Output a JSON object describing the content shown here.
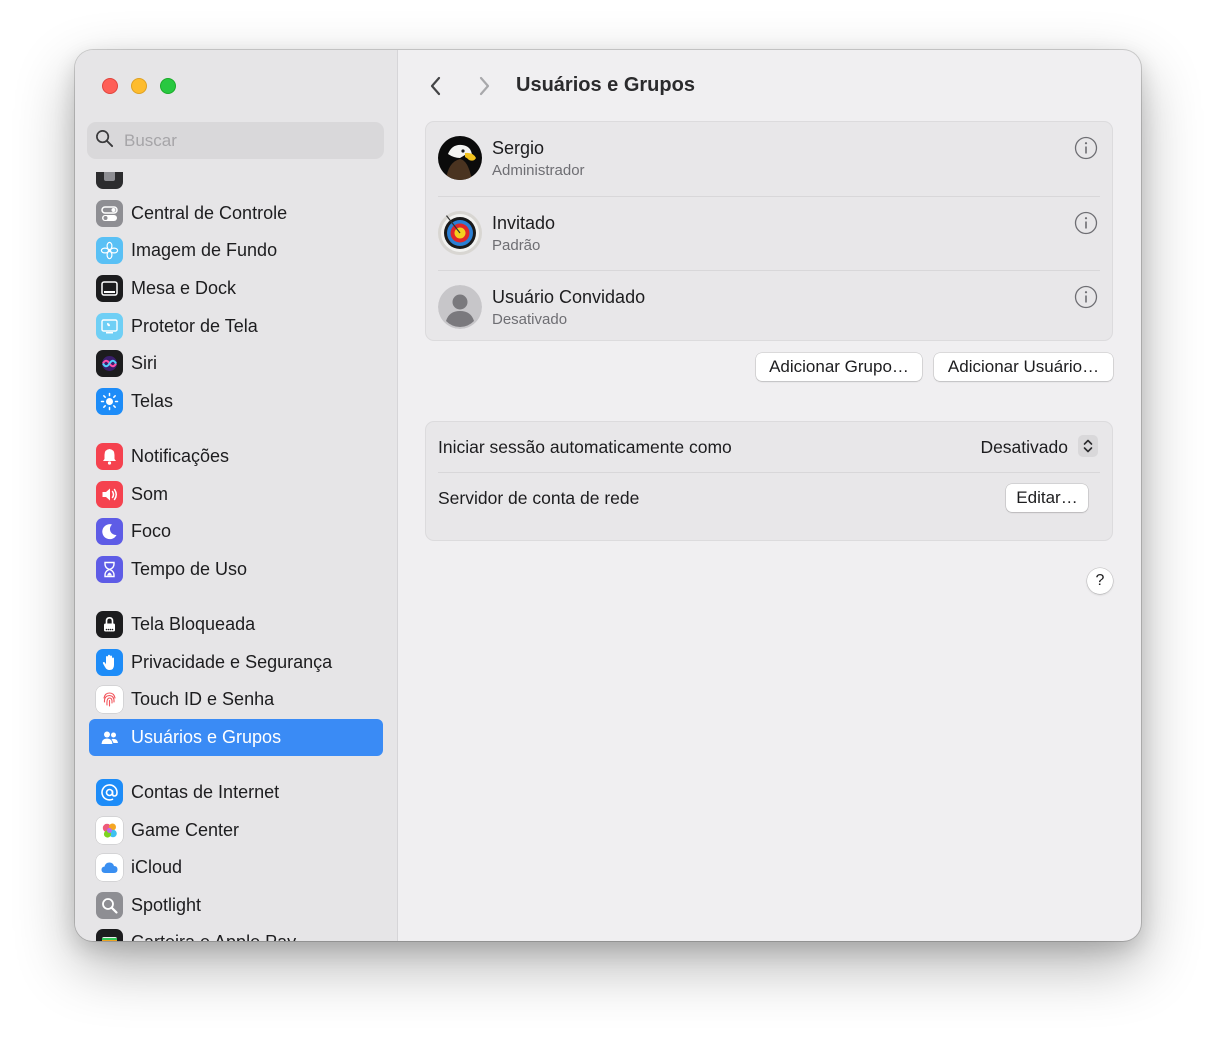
{
  "window": {
    "title": "Usuários e Grupos"
  },
  "search": {
    "placeholder": "Buscar"
  },
  "sidebar": {
    "items": [
      {
        "label": "",
        "icon": "partial-icon",
        "color": "#2c2c2e",
        "group": 0
      },
      {
        "label": "Central de Controle",
        "icon": "toggles-icon",
        "color": "#8e8e93",
        "group": 0
      },
      {
        "label": "Imagem de Fundo",
        "icon": "flower-icon",
        "color": "#59c0f5",
        "group": 0
      },
      {
        "label": "Mesa e Dock",
        "icon": "dock-icon",
        "color": "#1c1c1e",
        "group": 0
      },
      {
        "label": "Protetor de Tela",
        "icon": "screensaver-icon",
        "color": "#6fcff5",
        "group": 0
      },
      {
        "label": "Siri",
        "icon": "siri-icon",
        "color": "#1c1c1e",
        "group": 0
      },
      {
        "label": "Telas",
        "icon": "sun-icon",
        "color": "#1d8cf8",
        "group": 0
      },
      {
        "label": "Notificações",
        "icon": "bell-icon",
        "color": "#f5424f",
        "group": 1
      },
      {
        "label": "Som",
        "icon": "speaker-icon",
        "color": "#f5424f",
        "group": 1
      },
      {
        "label": "Foco",
        "icon": "moon-icon",
        "color": "#5e5ce6",
        "group": 1
      },
      {
        "label": "Tempo de Uso",
        "icon": "hourglass-icon",
        "color": "#5e5ce6",
        "group": 1
      },
      {
        "label": "Tela Bloqueada",
        "icon": "lock-icon",
        "color": "#1c1c1e",
        "group": 2
      },
      {
        "label": "Privacidade e Segurança",
        "icon": "hand-icon",
        "color": "#1d8cf8",
        "group": 2
      },
      {
        "label": "Touch ID e Senha",
        "icon": "fingerprint-icon",
        "color": "#ffffff",
        "group": 2
      },
      {
        "label": "Usuários e Grupos",
        "icon": "users-icon",
        "color": "#1d8cf8",
        "group": 2,
        "selected": true
      },
      {
        "label": "Contas de Internet",
        "icon": "at-icon",
        "color": "#1d8cf8",
        "group": 3
      },
      {
        "label": "Game Center",
        "icon": "gamecenter-icon",
        "color": "#ffffff",
        "group": 3
      },
      {
        "label": "iCloud",
        "icon": "cloud-icon",
        "color": "#ffffff",
        "group": 3
      },
      {
        "label": "Spotlight",
        "icon": "magnifier-icon",
        "color": "#8e8e93",
        "group": 3
      },
      {
        "label": "Carteira e Apple Pay",
        "icon": "wallet-icon",
        "color": "#1c1c1e",
        "group": 3
      }
    ]
  },
  "users": [
    {
      "name": "Sergio",
      "role": "Administrador",
      "avatar": "eagle-avatar"
    },
    {
      "name": "Invitado",
      "role": "Padrão",
      "avatar": "target-avatar"
    },
    {
      "name": "Usuário Convidado",
      "role": "Desativado",
      "avatar": "person-avatar"
    }
  ],
  "actions": {
    "add_group": "Adicionar Grupo…",
    "add_user": "Adicionar Usuário…"
  },
  "settings": {
    "autologin_label": "Iniciar sessão automaticamente como",
    "autologin_value": "Desativado",
    "network_label": "Servidor de conta de rede",
    "edit_label": "Editar…"
  },
  "help": {
    "label": "?"
  },
  "colors": {
    "accent": "#3a8bf5",
    "sidebar_bg": "#e6e5e7",
    "main_bg": "#f0eff1"
  }
}
